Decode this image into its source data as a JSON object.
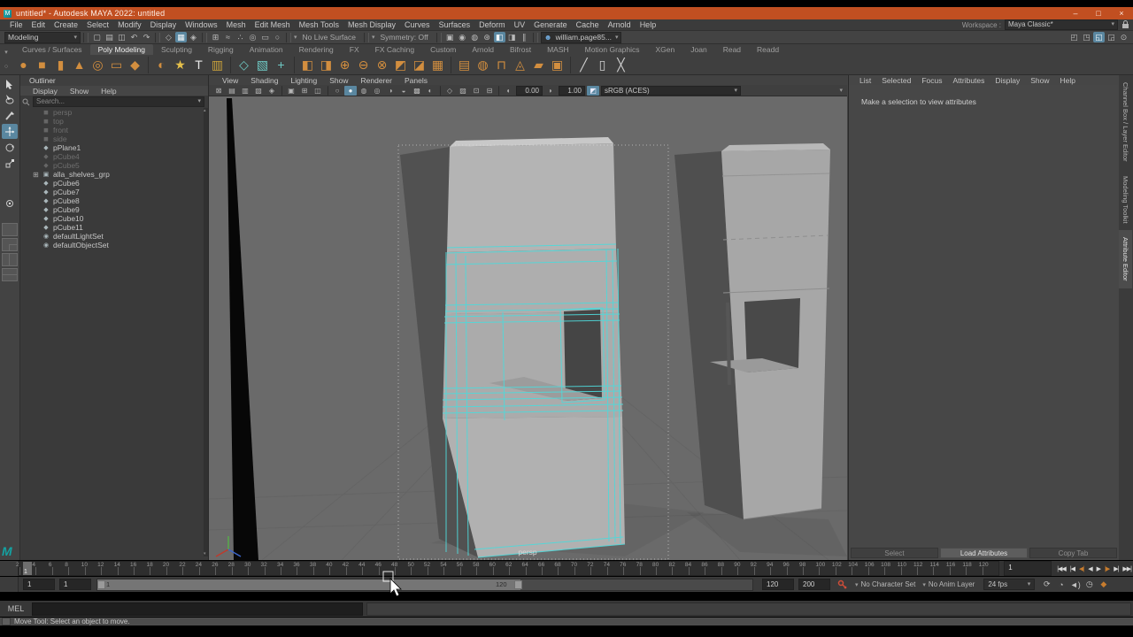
{
  "title_bar": {
    "title": "untitled* - Autodesk MAYA 2022: untitled",
    "app_initial": "M",
    "minimize": "–",
    "maximize": "□",
    "close": "×"
  },
  "menu_bar": {
    "items": [
      "File",
      "Edit",
      "Create",
      "Select",
      "Modify",
      "Display",
      "Windows",
      "Mesh",
      "Edit Mesh",
      "Mesh Tools",
      "Mesh Display",
      "Curves",
      "Surfaces",
      "Deform",
      "UV",
      "Generate",
      "Cache",
      "Arnold",
      "Help"
    ],
    "workspace_label": "Workspace :",
    "workspace_value": "Maya Classic*",
    "workspace_caret": "▾"
  },
  "status_line": {
    "mode_selector": "Modeling",
    "mode_caret": "▾",
    "file_icons": [
      {
        "name": "new-scene",
        "glyph": "▢"
      },
      {
        "name": "open-scene",
        "glyph": "▤"
      },
      {
        "name": "save-scene",
        "glyph": "◫"
      },
      {
        "name": "undo",
        "glyph": "↶"
      },
      {
        "name": "redo",
        "glyph": "↷"
      }
    ],
    "selection_icons": [
      {
        "name": "select-by-hierarchy",
        "glyph": "◇"
      },
      {
        "name": "select-by-object",
        "glyph": "▦",
        "mod": "active"
      },
      {
        "name": "select-by-component",
        "glyph": "◈"
      }
    ],
    "snap_icons": [
      {
        "name": "snap-to-grid",
        "glyph": "⊞"
      },
      {
        "name": "snap-to-curve",
        "glyph": "≈"
      },
      {
        "name": "snap-to-point",
        "glyph": "∴"
      },
      {
        "name": "snap-to-projected-center",
        "glyph": "◎"
      },
      {
        "name": "snap-to-view-plane",
        "glyph": "▭"
      },
      {
        "name": "make-object-live",
        "glyph": "○"
      }
    ],
    "no_live_surface": "No Live Surface",
    "symmetry": "Symmetry: Off",
    "render_icons": [
      {
        "name": "open-render-view",
        "glyph": "▣"
      },
      {
        "name": "render-current-frame",
        "glyph": "◉"
      },
      {
        "name": "ipr-render",
        "glyph": "◍"
      },
      {
        "name": "render-settings",
        "glyph": "⊛"
      },
      {
        "name": "display-rgb",
        "glyph": "◧",
        "mod": "active"
      },
      {
        "name": "display-alpha",
        "glyph": "◨"
      },
      {
        "name": "pause-viewport",
        "glyph": "∥"
      }
    ],
    "account": "william.page85...",
    "account_icon": "☻",
    "panel_toggle_icons": [
      {
        "name": "toggle-modeling-toolkit",
        "glyph": "◰"
      },
      {
        "name": "toggle-humanik",
        "glyph": "◳"
      },
      {
        "name": "toggle-channel-box",
        "glyph": "◱",
        "mod": "active"
      },
      {
        "name": "toggle-tool-settings",
        "glyph": "◲"
      },
      {
        "name": "toggle-attribute-editor",
        "glyph": "⊙"
      }
    ]
  },
  "shelf": {
    "tabs": [
      {
        "label": "Curves / Surfaces"
      },
      {
        "label": "Poly Modeling",
        "mod": "active"
      },
      {
        "label": "Sculpting"
      },
      {
        "label": "Rigging"
      },
      {
        "label": "Animation"
      },
      {
        "label": "Rendering"
      },
      {
        "label": "FX"
      },
      {
        "label": "FX Caching"
      },
      {
        "label": "Custom"
      },
      {
        "label": "Arnold"
      },
      {
        "label": "Bifrost"
      },
      {
        "label": "MASH"
      },
      {
        "label": "Motion Graphics"
      },
      {
        "label": "XGen"
      },
      {
        "label": "Joan"
      },
      {
        "label": "Read"
      },
      {
        "label": "Readd"
      }
    ],
    "icons": [
      {
        "name": "poly-sphere",
        "glyph": "●",
        "color": "#d28e3f"
      },
      {
        "name": "poly-cube",
        "glyph": "■",
        "color": "#d28e3f"
      },
      {
        "name": "poly-cylinder",
        "glyph": "▮",
        "color": "#d28e3f"
      },
      {
        "name": "poly-cone",
        "glyph": "▲",
        "color": "#d28e3f"
      },
      {
        "name": "poly-torus",
        "glyph": "◎",
        "color": "#d28e3f"
      },
      {
        "name": "poly-plane",
        "glyph": "▭",
        "color": "#d28e3f"
      },
      {
        "name": "poly-disc",
        "glyph": "◆",
        "color": "#d28e3f"
      },
      {
        "name": "platonic-solid",
        "glyph": "◐",
        "color": "#d28e3f",
        "mod": "sepb"
      },
      {
        "name": "super-shape",
        "glyph": "★",
        "color": "#e5c04a"
      },
      {
        "name": "poly-type",
        "glyph": "T",
        "color": "#e8e8e8"
      },
      {
        "name": "svg-tool",
        "glyph": "▥",
        "color": "#caa23a"
      },
      {
        "name": "construction-plane",
        "glyph": "◇",
        "color": "#6fc9c4",
        "mod": "sepb"
      },
      {
        "name": "free-image-plane",
        "glyph": "▧",
        "color": "#6fc9c4"
      },
      {
        "name": "locator",
        "glyph": "+",
        "color": "#6fc9c4"
      },
      {
        "name": "combine",
        "glyph": "◧",
        "color": "#d28e3f",
        "mod": "sepb"
      },
      {
        "name": "separate",
        "glyph": "◨",
        "color": "#d28e3f"
      },
      {
        "name": "boolean-union",
        "glyph": "⊕",
        "color": "#d28e3f"
      },
      {
        "name": "boolean-difference",
        "glyph": "⊖",
        "color": "#d28e3f"
      },
      {
        "name": "boolean-intersection",
        "glyph": "⊗",
        "color": "#d28e3f"
      },
      {
        "name": "smooth",
        "glyph": "◩",
        "color": "#d28e3f"
      },
      {
        "name": "reduce",
        "glyph": "◪",
        "color": "#d28e3f"
      },
      {
        "name": "remesh",
        "glyph": "▦",
        "color": "#d28e3f"
      },
      {
        "name": "extrude",
        "glyph": "▤",
        "color": "#d28e3f",
        "mod": "sepb"
      },
      {
        "name": "bevel",
        "glyph": "◍",
        "color": "#d28e3f"
      },
      {
        "name": "bridge",
        "glyph": "⊓",
        "color": "#d28e3f"
      },
      {
        "name": "circularize",
        "glyph": "◬",
        "color": "#d28e3f"
      },
      {
        "name": "mirror",
        "glyph": "▰",
        "color": "#d28e3f"
      },
      {
        "name": "project-curve",
        "glyph": "▣",
        "color": "#d28e3f"
      },
      {
        "name": "multi-cut",
        "glyph": "╱",
        "color": "#cfcfcf",
        "mod": "sepb"
      },
      {
        "name": "insert-edge-loop",
        "glyph": "▯",
        "color": "#cfcfcf"
      },
      {
        "name": "offset-edge-loop",
        "glyph": "╳",
        "color": "#cfcfcf"
      }
    ],
    "side_buttons": [
      {
        "name": "shelf-tab-options",
        "glyph": "▾"
      },
      {
        "name": "shelf-menu",
        "glyph": "○"
      }
    ]
  },
  "outliner": {
    "title": "Outliner",
    "menus": [
      "Display",
      "Show",
      "Help"
    ],
    "search_placeholder": "Search...",
    "search_caret": "▾",
    "items": [
      {
        "label": "persp",
        "icon": "camera",
        "glyph": "◼",
        "mod": "dim"
      },
      {
        "label": "top",
        "icon": "camera",
        "glyph": "◼",
        "mod": "dim"
      },
      {
        "label": "front",
        "icon": "camera",
        "glyph": "◼",
        "mod": "dim"
      },
      {
        "label": "side",
        "icon": "camera",
        "glyph": "◼",
        "mod": "dim"
      },
      {
        "label": "pPlane1",
        "icon": "mesh",
        "glyph": "◆"
      },
      {
        "label": "pCube4",
        "icon": "mesh",
        "glyph": "◆",
        "mod": "dim"
      },
      {
        "label": "pCube5",
        "icon": "mesh",
        "glyph": "◆",
        "mod": "dim"
      },
      {
        "label": "alla_shelves_grp",
        "icon": "group",
        "glyph": "▣",
        "mod": "exp"
      },
      {
        "label": "pCube6",
        "icon": "mesh",
        "glyph": "◆"
      },
      {
        "label": "pCube7",
        "icon": "mesh",
        "glyph": "◆"
      },
      {
        "label": "pCube8",
        "icon": "mesh",
        "glyph": "◆"
      },
      {
        "label": "pCube9",
        "icon": "mesh",
        "glyph": "◆"
      },
      {
        "label": "pCube10",
        "icon": "mesh",
        "glyph": "◆"
      },
      {
        "label": "pCube11",
        "icon": "mesh",
        "glyph": "◆"
      },
      {
        "label": "defaultLightSet",
        "icon": "set",
        "glyph": "◉"
      },
      {
        "label": "defaultObjectSet",
        "icon": "set",
        "glyph": "◉"
      }
    ],
    "expander_glyph": "⊞"
  },
  "viewport": {
    "menus": [
      "View",
      "Shading",
      "Lighting",
      "Show",
      "Renderer",
      "Panels"
    ],
    "icons": [
      {
        "name": "lock-camera",
        "glyph": "⊠"
      },
      {
        "name": "camera-attributes",
        "glyph": "▤"
      },
      {
        "name": "bookmarks",
        "glyph": "▥"
      },
      {
        "name": "image-plane",
        "glyph": "▧"
      },
      {
        "name": "two-d-pan-zoom",
        "glyph": "◈"
      },
      {
        "name": "layout-single-pane",
        "glyph": "▣",
        "mod": "sepb"
      },
      {
        "name": "layout-four-pane",
        "glyph": "⊞"
      },
      {
        "name": "layout-three-pane",
        "glyph": "◫"
      },
      {
        "name": "wireframe-mode",
        "glyph": "○",
        "mod": "sepb"
      },
      {
        "name": "smooth-shade-mode",
        "glyph": "●",
        "mod": "active"
      },
      {
        "name": "textured-mode",
        "glyph": "◍"
      },
      {
        "name": "use-default-material",
        "glyph": "◎"
      },
      {
        "name": "lighting-all",
        "glyph": "◑"
      },
      {
        "name": "shadows",
        "glyph": "◒"
      },
      {
        "name": "occlusion",
        "glyph": "▩"
      },
      {
        "name": "motion-blur",
        "glyph": "◐"
      },
      {
        "name": "isolate-select",
        "glyph": "◇",
        "mod": "sepb"
      },
      {
        "name": "xray",
        "glyph": "▨"
      },
      {
        "name": "resolution-gate",
        "glyph": "⊡"
      },
      {
        "name": "gate-mask",
        "glyph": "⊟"
      }
    ],
    "exposure_icon": "◖",
    "exposure": "0.00",
    "gamma_icon": "◗",
    "gamma": "1.00",
    "colorspace": "sRGB (ACES)",
    "colorspace_caret": "▾",
    "camera_label": "persp"
  },
  "attribute_editor": {
    "menus": [
      "List",
      "Selected",
      "Focus",
      "Attributes",
      "Display",
      "Show",
      "Help"
    ],
    "message": "Make a selection to view attributes",
    "buttons": [
      {
        "label": "Select"
      },
      {
        "label": "Load Attributes",
        "mod": "lit"
      },
      {
        "label": "Copy Tab"
      }
    ]
  },
  "side_tabs": [
    {
      "label": "Channel Box / Layer Editor"
    },
    {
      "label": "Modeling Toolkit"
    },
    {
      "label": "Attribute Editor",
      "mod": "active"
    }
  ],
  "timeline": {
    "tick_labels": [
      2,
      4,
      6,
      8,
      10,
      12,
      14,
      16,
      18,
      20,
      22,
      24,
      26,
      28,
      30,
      32,
      34,
      36,
      38,
      40,
      42,
      44,
      46,
      48,
      50,
      52,
      54,
      56,
      58,
      60,
      62,
      64,
      66,
      68,
      70,
      72,
      74,
      76,
      78,
      80,
      82,
      84,
      86,
      88,
      90,
      92,
      94,
      96,
      98,
      100,
      102,
      104,
      106,
      108,
      110,
      112,
      114,
      116,
      118,
      120
    ],
    "current_frame": "1",
    "current_time_field": "1",
    "transport": [
      {
        "name": "go-to-start",
        "glyph": "|◀◀"
      },
      {
        "name": "step-back-frame",
        "glyph": "|◀"
      },
      {
        "name": "step-back-key",
        "glyph": "◀|",
        "mod": "key"
      },
      {
        "name": "play-backwards",
        "glyph": "◀"
      },
      {
        "name": "play-forwards",
        "glyph": "▶"
      },
      {
        "name": "step-forward-key",
        "glyph": "|▶",
        "mod": "key"
      },
      {
        "name": "step-forward-frame",
        "glyph": "▶|"
      },
      {
        "name": "go-to-end",
        "glyph": "▶▶|"
      }
    ]
  },
  "range_slider": {
    "anim_start": "1",
    "playback_start": "1",
    "inner_start_label": "1",
    "inner_end_label": "120",
    "playback_end": "120",
    "anim_end": "200",
    "character_set_caret": "▾",
    "character_set": "No Character Set",
    "anim_layer_caret": "▾",
    "anim_layer": "No Anim Layer",
    "fps": "24 fps",
    "fps_caret": "▾",
    "extra_icons": [
      {
        "name": "playback-loop",
        "glyph": "⟳"
      },
      {
        "name": "animation-preferences",
        "glyph": "◔"
      },
      {
        "name": "mute-audio",
        "glyph": "◄)"
      },
      {
        "name": "playback-speed",
        "glyph": "◷"
      },
      {
        "name": "auto-keyframe",
        "glyph": "◆",
        "mod": "warm"
      }
    ]
  },
  "command_line": {
    "label": "MEL"
  },
  "help_line": {
    "message": "Move Tool: Select an object to move."
  },
  "colors": {
    "titlebar_orange": "#c14f21",
    "viewport_gray": "#6a6a6a",
    "selection_wireframe_cyan": "#4fd9da",
    "active_highlight_blue": "#5a87a0",
    "shelf_icon_orange": "#d28e3f"
  }
}
